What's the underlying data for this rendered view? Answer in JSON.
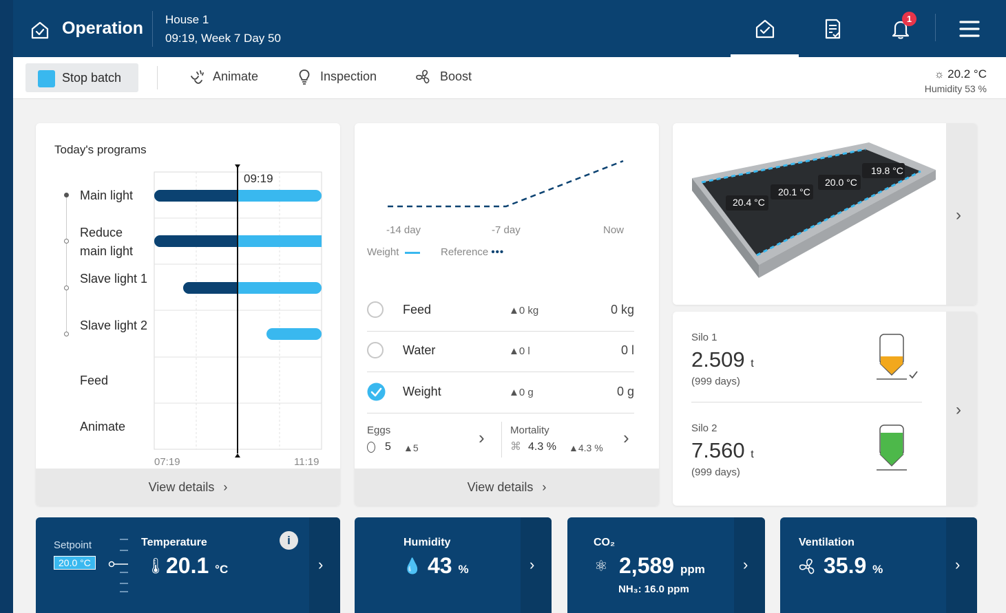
{
  "header": {
    "title": "Operation",
    "house": "House 1",
    "time": "09:19, Week 7 Day 50",
    "notification_count": "1"
  },
  "toolbar": {
    "stop_batch": "Stop batch",
    "animate": "Animate",
    "inspection": "Inspection",
    "boost": "Boost",
    "outdoor_temp": "20.2 °C",
    "outdoor_humidity": "Humidity 53 %"
  },
  "programs": {
    "title": "Today's programs",
    "current_time": "09:19",
    "axis_start": "07:19",
    "axis_end": "11:19",
    "rows": [
      {
        "label": "Main light"
      },
      {
        "label": "Reduce main light"
      },
      {
        "label": "Slave light 1"
      },
      {
        "label": "Slave light 2"
      },
      {
        "label": "Feed"
      },
      {
        "label": "Animate"
      }
    ],
    "view_details": "View details"
  },
  "weight_card": {
    "axis": [
      "-14 day",
      "-7 day",
      "Now"
    ],
    "legend_weight": "Weight",
    "legend_reference": "Reference",
    "rows": [
      {
        "label": "Feed",
        "delta": "▲0 kg",
        "value": "0 kg",
        "checked": false
      },
      {
        "label": "Water",
        "delta": "▲0 l",
        "value": "0 l",
        "checked": false
      },
      {
        "label": "Weight",
        "delta": "▲0 g",
        "value": "0 g",
        "checked": true
      }
    ],
    "eggs_label": "Eggs",
    "eggs_value": "5",
    "eggs_delta": "▲5",
    "mortality_label": "Mortality",
    "mortality_value": "4.3 %",
    "mortality_delta": "▲4.3 %",
    "view_details": "View details"
  },
  "house_view": {
    "temps": [
      "19.8 °C",
      "20.0 °C",
      "20.1 °C",
      "20.4 °C"
    ]
  },
  "silos": [
    {
      "label": "Silo 1",
      "value": "2.509",
      "unit": "t",
      "days": "(999 days)",
      "fill": 0.28,
      "fill_color": "#f2a81d"
    },
    {
      "label": "Silo 2",
      "value": "7.560",
      "unit": "t",
      "days": "(999 days)",
      "fill": 0.75,
      "fill_color": "#4db84a"
    }
  ],
  "tiles": {
    "setpoint_label": "Setpoint",
    "setpoint_value": "20.0 °C",
    "temperature_title": "Temperature",
    "temperature_value": "20.1",
    "temperature_unit": "°C",
    "humidity_title": "Humidity",
    "humidity_value": "43",
    "humidity_unit": "%",
    "co2_title": "CO₂",
    "co2_value": "2,589",
    "co2_unit": "ppm",
    "nh3": "NH₃: 16.0 ppm",
    "ventilation_title": "Ventilation",
    "ventilation_value": "35.9",
    "ventilation_unit": "%"
  },
  "colors": {
    "header": "#0b4271",
    "accent": "#39b8ef",
    "dark_bar": "#0b4271"
  }
}
